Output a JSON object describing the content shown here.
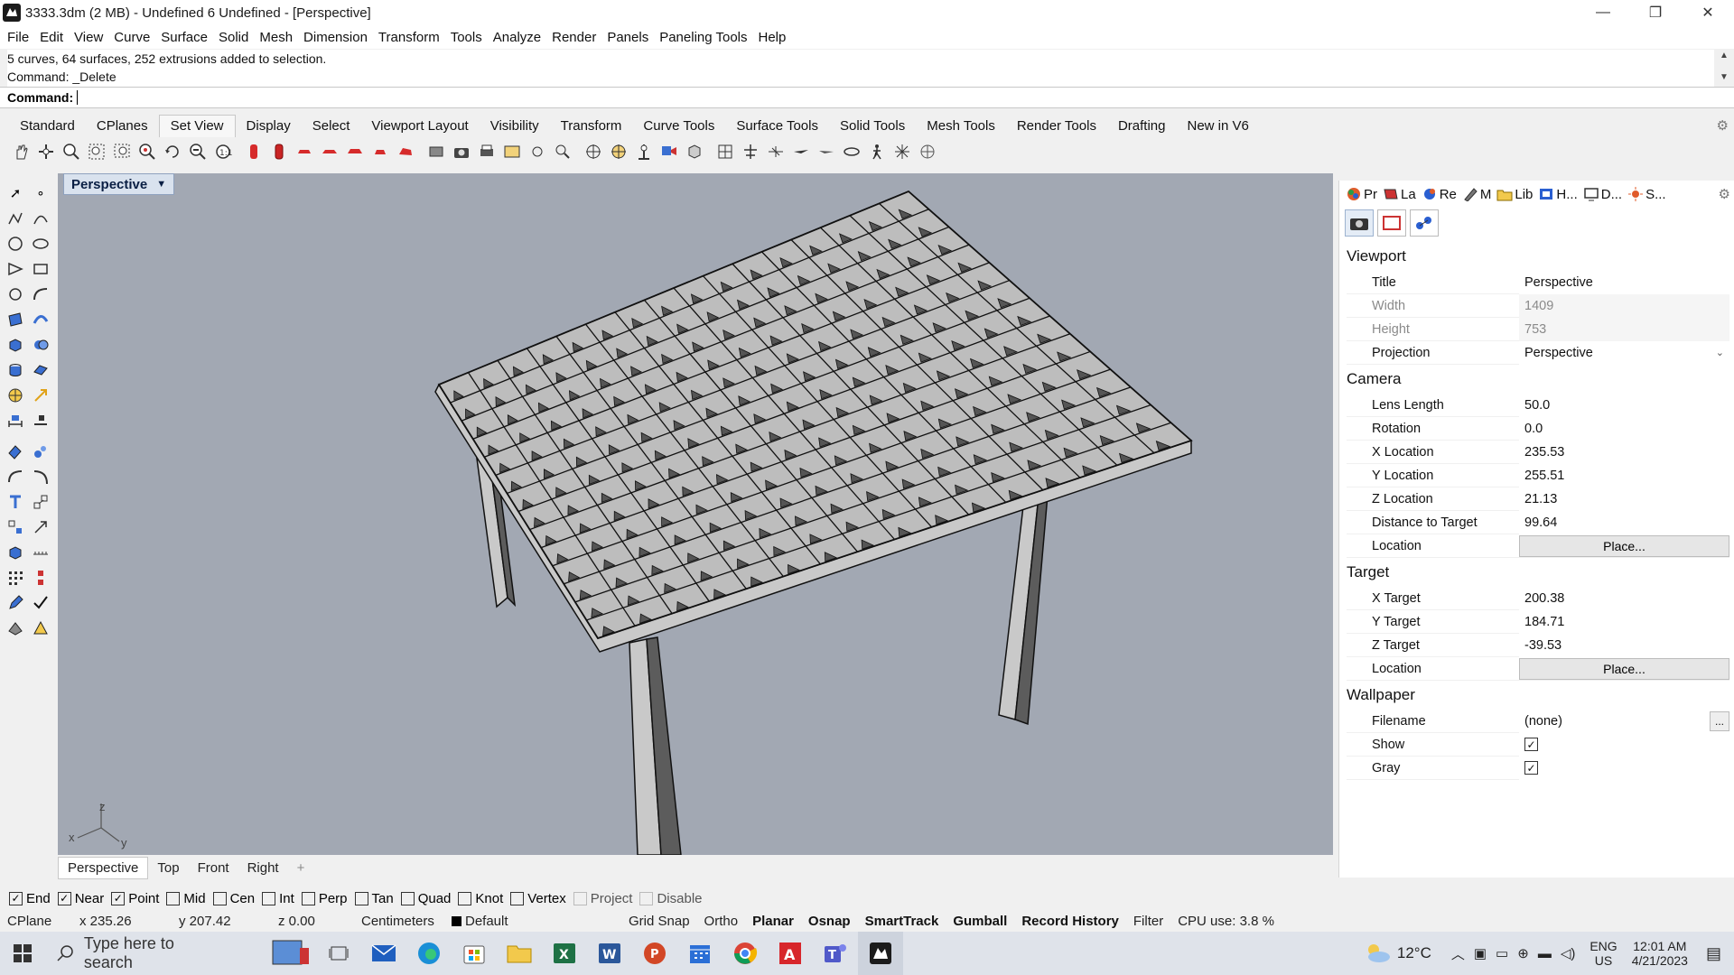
{
  "window": {
    "title": "3333.3dm (2 MB) - Undefined 6 Undefined - [Perspective]",
    "minimize": "—",
    "maximize": "❐",
    "close": "✕"
  },
  "menu": [
    "File",
    "Edit",
    "View",
    "Curve",
    "Surface",
    "Solid",
    "Mesh",
    "Dimension",
    "Transform",
    "Tools",
    "Analyze",
    "Render",
    "Panels",
    "Paneling Tools",
    "Help"
  ],
  "command": {
    "history": [
      "5 curves, 64 surfaces, 252 extrusions added to selection.",
      "Command: _Delete"
    ],
    "prompt": "Command:"
  },
  "toolbar_tabs": [
    "Standard",
    "CPlanes",
    "Set View",
    "Display",
    "Select",
    "Viewport Layout",
    "Visibility",
    "Transform",
    "Curve Tools",
    "Surface Tools",
    "Solid Tools",
    "Mesh Tools",
    "Render Tools",
    "Drafting",
    "New in V6"
  ],
  "active_tab": "Set View",
  "viewport": {
    "label": "Perspective",
    "axis": {
      "x": "x",
      "y": "y",
      "z": "z"
    },
    "tabs": [
      "Perspective",
      "Top",
      "Front",
      "Right"
    ],
    "add_tab": "+"
  },
  "panel": {
    "tabs": [
      {
        "label": "Pr",
        "icon": "properties-icon"
      },
      {
        "label": "La",
        "icon": "layers-icon"
      },
      {
        "label": "Re",
        "icon": "render-icon"
      },
      {
        "label": "M",
        "icon": "materials-icon"
      },
      {
        "label": "Lib",
        "icon": "libraries-icon"
      },
      {
        "label": "H...",
        "icon": "help-icon"
      },
      {
        "label": "D...",
        "icon": "display-icon"
      },
      {
        "label": "S...",
        "icon": "sun-icon"
      }
    ],
    "sections": {
      "viewport": "Viewport",
      "camera": "Camera",
      "target": "Target",
      "wallpaper": "Wallpaper"
    },
    "viewport_props": {
      "title_label": "Title",
      "title": "Perspective",
      "width_label": "Width",
      "width": "1409",
      "height_label": "Height",
      "height": "753",
      "projection_label": "Projection",
      "projection": "Perspective"
    },
    "camera_props": {
      "lens_label": "Lens Length",
      "lens": "50.0",
      "rotation_label": "Rotation",
      "rotation": "0.0",
      "xloc_label": "X Location",
      "xloc": "235.53",
      "yloc_label": "Y Location",
      "yloc": "255.51",
      "zloc_label": "Z Location",
      "zloc": "21.13",
      "dist_label": "Distance to Target",
      "dist": "99.64",
      "location_label": "Location",
      "place": "Place..."
    },
    "target_props": {
      "x_label": "X Target",
      "x": "200.38",
      "y_label": "Y Target",
      "y": "184.71",
      "z_label": "Z Target",
      "z": "-39.53",
      "location_label": "Location",
      "place": "Place..."
    },
    "wallpaper_props": {
      "filename_label": "Filename",
      "filename": "(none)",
      "browse": "...",
      "show_label": "Show",
      "gray_label": "Gray",
      "check": "✓"
    }
  },
  "osnaps": [
    {
      "label": "End",
      "checked": true
    },
    {
      "label": "Near",
      "checked": true
    },
    {
      "label": "Point",
      "checked": true
    },
    {
      "label": "Mid",
      "checked": false
    },
    {
      "label": "Cen",
      "checked": false
    },
    {
      "label": "Int",
      "checked": false
    },
    {
      "label": "Perp",
      "checked": false
    },
    {
      "label": "Tan",
      "checked": false
    },
    {
      "label": "Quad",
      "checked": false
    },
    {
      "label": "Knot",
      "checked": false
    },
    {
      "label": "Vertex",
      "checked": false
    },
    {
      "label": "Project",
      "checked": false,
      "disabled": true
    },
    {
      "label": "Disable",
      "checked": false,
      "disabled": true
    }
  ],
  "status": {
    "cplane": "CPlane",
    "x": "x 235.26",
    "y": "y 207.42",
    "z": "z 0.00",
    "units": "Centimeters",
    "layer": "Default",
    "grid_snap": "Grid Snap",
    "ortho": "Ortho",
    "planar": "Planar",
    "osnap": "Osnap",
    "smarttrack": "SmartTrack",
    "gumball": "Gumball",
    "record_history": "Record History",
    "filter": "Filter",
    "cpu": "CPU use: 3.8 %"
  },
  "taskbar": {
    "search_placeholder": "Type here to search",
    "weather": "12°C",
    "lang": "ENG",
    "region": "US",
    "time": "12:01 AM",
    "date": "4/21/2023"
  },
  "colors": {
    "viewport_bg": "#a2a8b3",
    "model_face": "#c9c9c9",
    "model_shadow": "#5c5c5c",
    "model_edge": "#111111"
  }
}
